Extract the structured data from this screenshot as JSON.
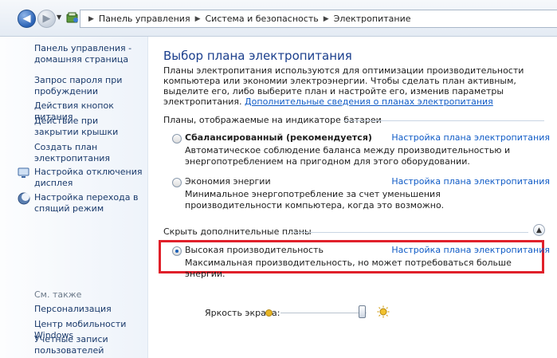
{
  "address_bar": {
    "breadcrumbs": [
      "Панель управления",
      "Система и безопасность",
      "Электропитание"
    ]
  },
  "left_pane": {
    "home_link": "Панель управления - домашняя страница",
    "links": [
      {
        "label": "Запрос пароля при пробуждении"
      },
      {
        "label": "Действия кнопок питания"
      },
      {
        "label": "Действие при закрытии крышки"
      },
      {
        "label": "Создать план электропитания"
      },
      {
        "label": "Настройка отключения дисплея",
        "icon": "display-icon"
      },
      {
        "label": "Настройка перехода в спящий режим",
        "icon": "sleep-icon"
      }
    ],
    "see_also_title": "См. также",
    "see_also": [
      "Персонализация",
      "Центр мобильности Windows",
      "Учетные записи пользователей"
    ]
  },
  "main": {
    "title": "Выбор плана электропитания",
    "intro": "Планы электропитания используются для оптимизации производительности компьютера или экономии электроэнергии. Чтобы сделать план активным, выделите его, либо выберите план и настройте его, изменив параметры электропитания. ",
    "intro_link": "Дополнительные сведения о планах электропитания",
    "battery_group_title": "Планы, отображаемые на индикаторе батареи",
    "hidden_group_title": "Скрыть дополнительные планы",
    "settings_link": "Настройка плана электропитания",
    "plans": [
      {
        "name": "Сбалансированный (рекомендуется)",
        "selected": false,
        "description": "Автоматическое соблюдение баланса между производительностью и энергопотреблением на пригодном для этого оборудовании."
      },
      {
        "name": "Экономия энергии",
        "selected": false,
        "description": "Минимальное энергопотребление за счет уменьшения производительности компьютера, когда это возможно."
      },
      {
        "name": "Высокая производительность",
        "selected": true,
        "description": "Максимальная производительность, но может потребоваться больше энергии."
      }
    ]
  },
  "brightness": {
    "label": "Яркость экрана:",
    "level": 0.95
  },
  "colors": {
    "link": "#0f5bc6",
    "title": "#1b3f8d",
    "highlight": "#e0202a"
  }
}
